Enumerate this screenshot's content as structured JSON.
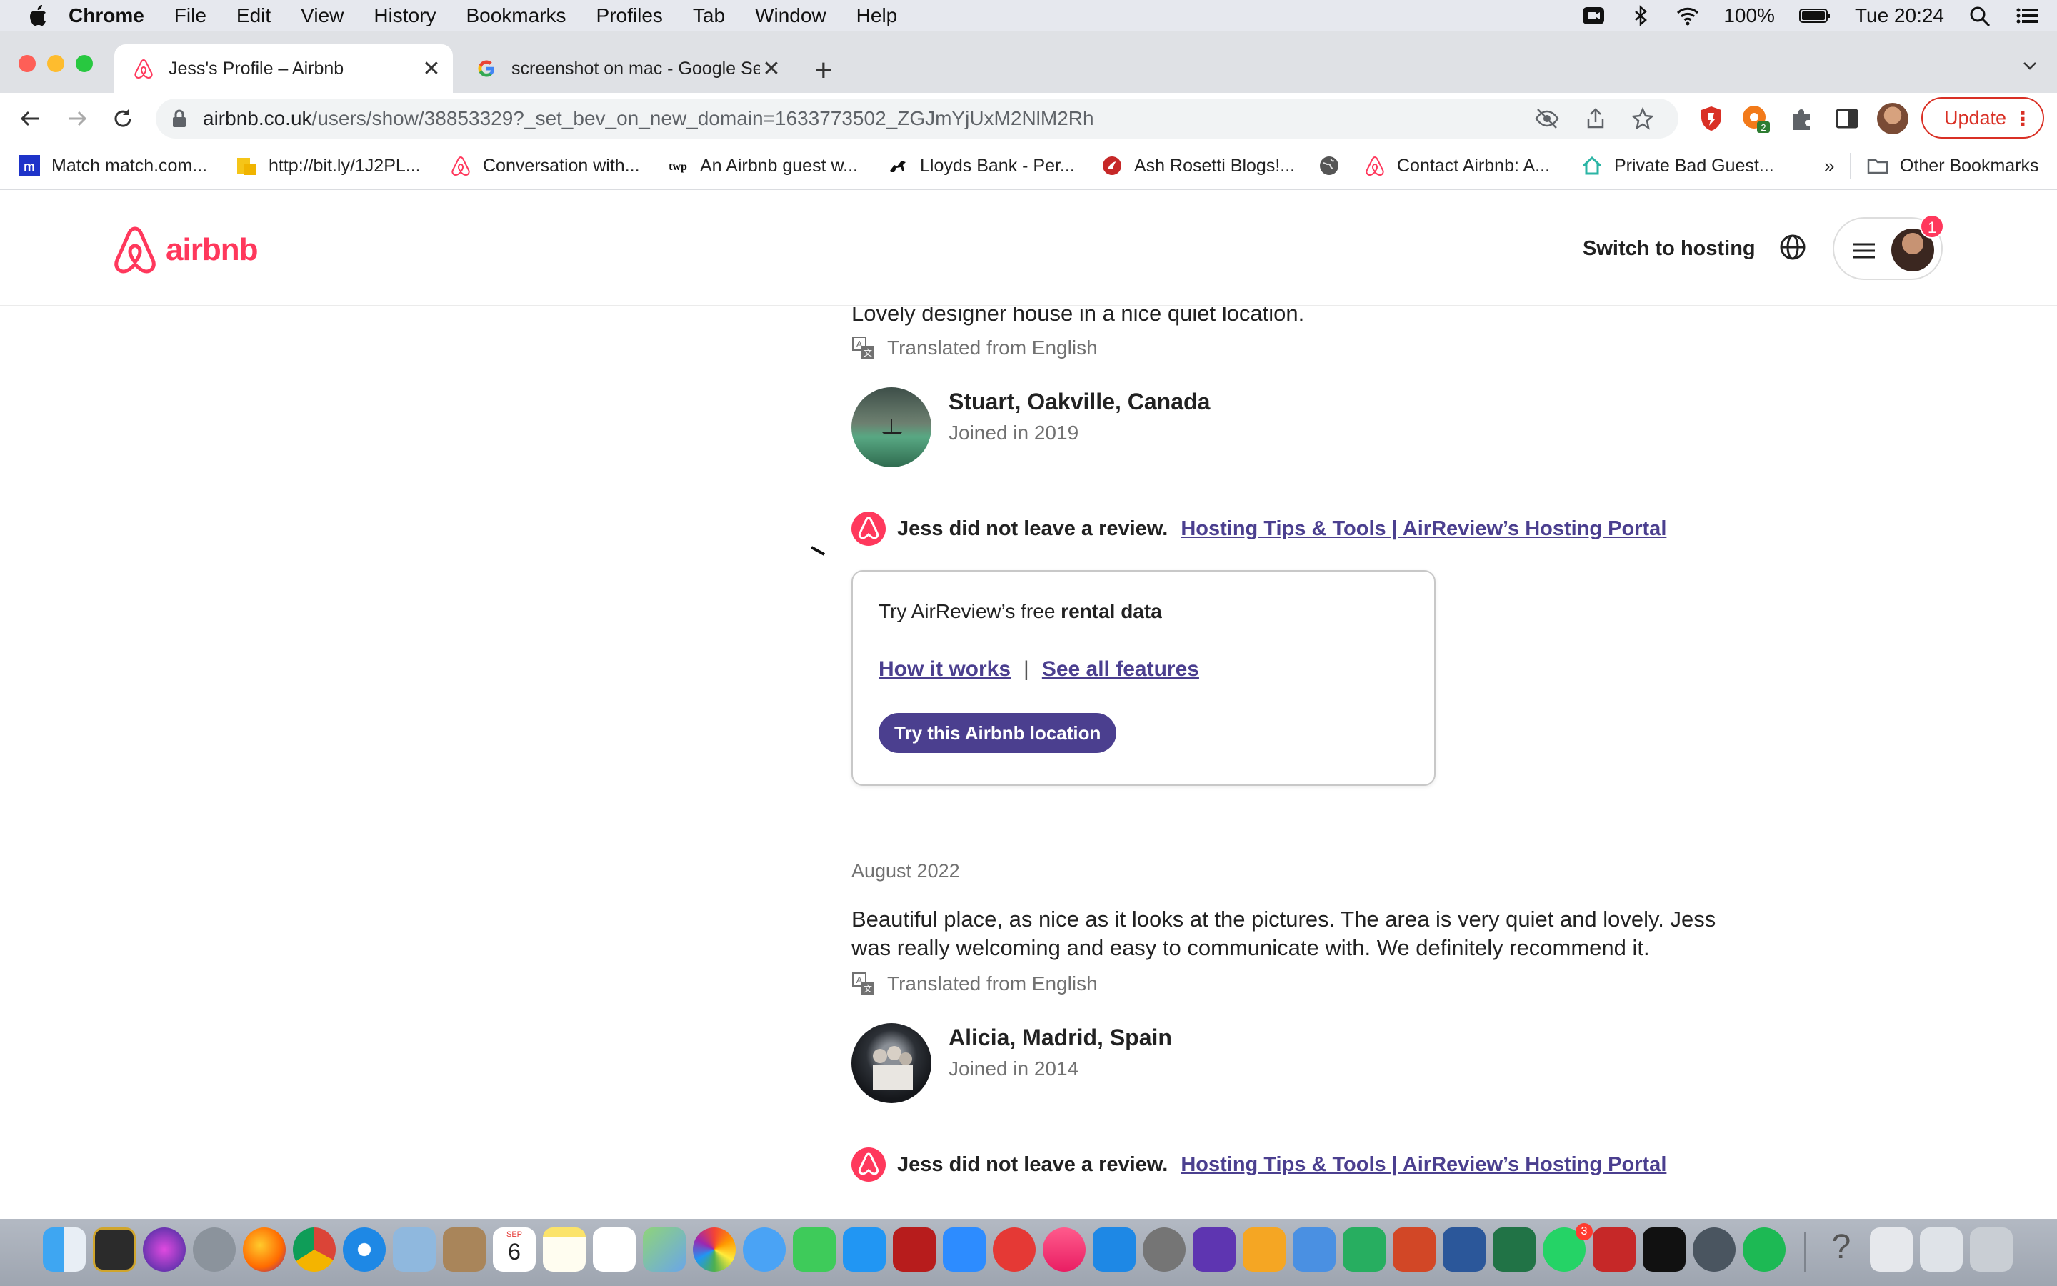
{
  "menubar": {
    "app": "Chrome",
    "items": [
      "File",
      "Edit",
      "View",
      "History",
      "Bookmarks",
      "Profiles",
      "Tab",
      "Window",
      "Help"
    ],
    "battery": "100%",
    "clock": "Tue 20:24",
    "icons": [
      "apple-icon",
      "screen-record-icon",
      "bluetooth-icon",
      "wifi-icon",
      "battery-icon",
      "spotlight-icon",
      "control-center-icon"
    ]
  },
  "tabs": [
    {
      "title": "Jess's Profile – Airbnb",
      "active": true,
      "favicon": "airbnb-icon"
    },
    {
      "title": "screenshot on mac - Google Se",
      "active": false,
      "favicon": "google-icon"
    }
  ],
  "toolbar": {
    "url_host": "airbnb.co.uk",
    "url_path": "/users/show/38853329?_set_bev_on_new_domain=1633773502_ZGJmYjUxM2NlM2Rh",
    "update_label": "Update"
  },
  "bookmarks": [
    {
      "label": "Match match.com...",
      "icon": "match-icon"
    },
    {
      "label": "http://bit.ly/1J2PL...",
      "icon": "folder-yellow-icon"
    },
    {
      "label": "Conversation with...",
      "icon": "airbnb-icon"
    },
    {
      "label": "An Airbnb guest w...",
      "icon": "twp-icon"
    },
    {
      "label": "Lloyds Bank - Per...",
      "icon": "lloyds-horse-icon"
    },
    {
      "label": "Ash Rosetti Blogs!...",
      "icon": "blog-icon"
    },
    {
      "label": "",
      "icon": "globe-icon"
    },
    {
      "label": "Contact Airbnb: A...",
      "icon": "airbnb-icon"
    },
    {
      "label": "Private Bad Guest...",
      "icon": "house-icon"
    }
  ],
  "bookmarks_more": "»",
  "bookmarks_other": "Other Bookmarks",
  "airbnb": {
    "logo_text": "airbnb",
    "switch_hosting": "Switch to hosting",
    "notification_count": "1"
  },
  "reviews": [
    {
      "text": "Lovely designer house in a nice quiet location.",
      "translated": "Translated from English",
      "reviewer": "Stuart, Oakville, Canada",
      "joined": "Joined in 2019",
      "no_review": "Jess did not leave a review.",
      "link": "Hosting Tips & Tools | AirReview’s Hosting Portal"
    },
    {
      "date": "August 2022",
      "text_line1": "Beautiful place, as nice as it looks at the pictures. The area is very quiet and lovely. Jess",
      "text_line2": "was really welcoming and easy to communicate with. We definitely recommend it.",
      "translated": "Translated from English",
      "reviewer": "Alicia, Madrid, Spain",
      "joined": "Joined in 2014",
      "no_review": "Jess did not leave a review.",
      "link": "Hosting Tips & Tools | AirReview’s Hosting Portal"
    }
  ],
  "airreview_card": {
    "prefix": "Try AirReview’s free ",
    "bold": "rental data",
    "how": "How it works",
    "sep": "|",
    "features": "See all features",
    "button": "Try this Airbnb location"
  },
  "dock": {
    "badges": {
      "whatsapp": "3",
      "calendar_day": "6",
      "calendar_month": "SEP"
    }
  }
}
